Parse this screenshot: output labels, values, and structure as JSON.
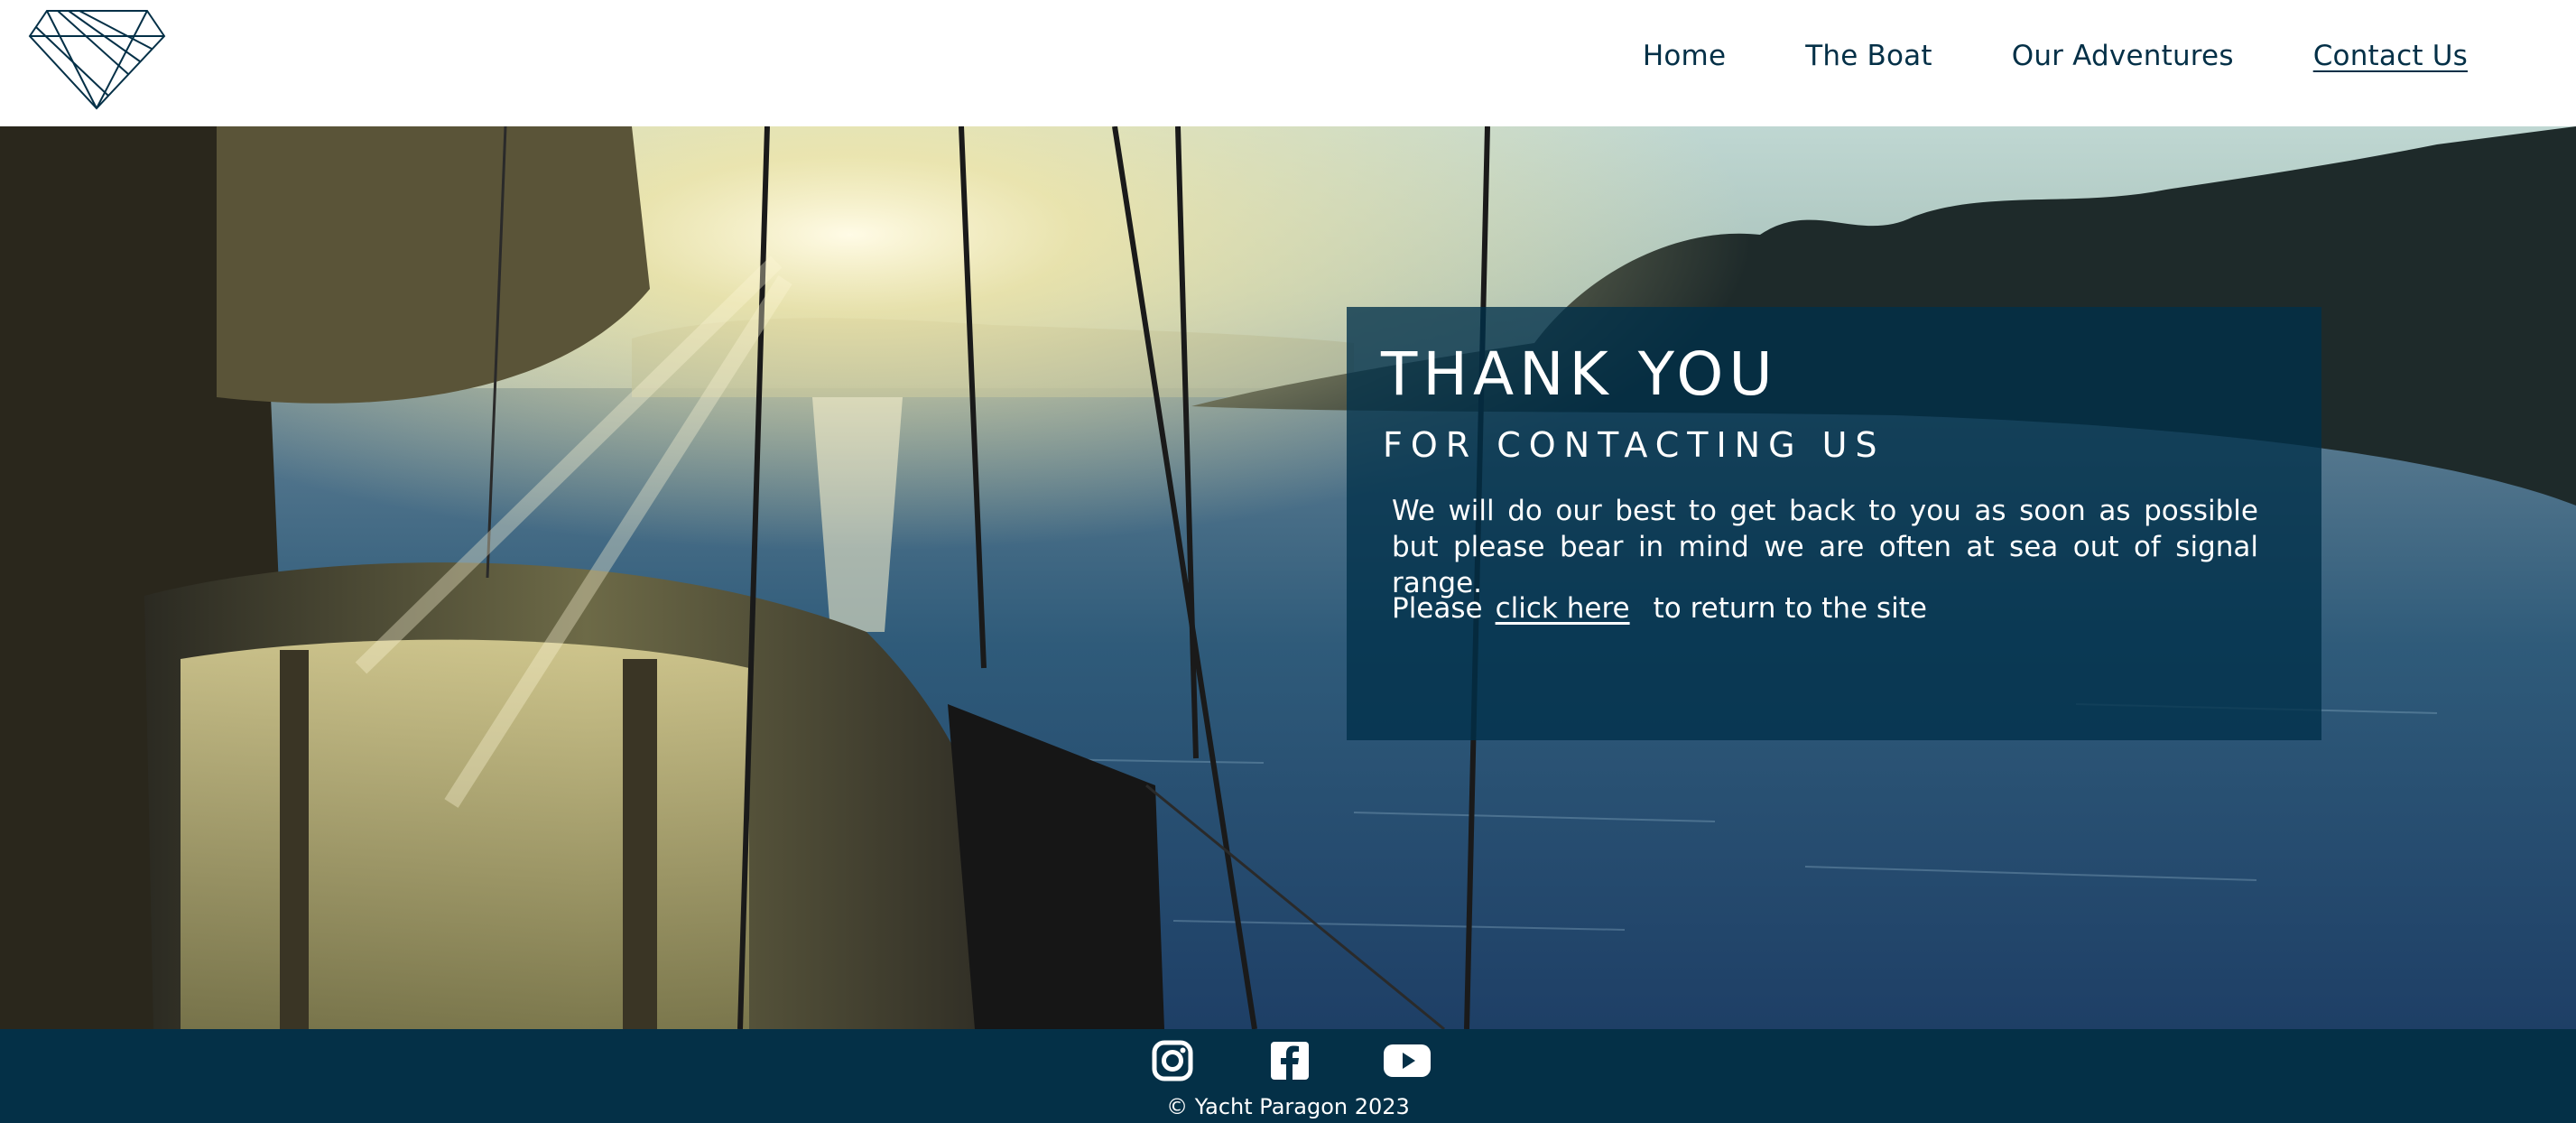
{
  "header": {
    "logo_icon": "diamond-logo-icon",
    "nav": [
      {
        "label": "Home"
      },
      {
        "label": "The Boat"
      },
      {
        "label": "Our Adventures"
      },
      {
        "label": "Contact Us",
        "active": true
      }
    ]
  },
  "hero": {
    "background_icon": "sailboat-sunset-photo",
    "title": "THANK YOU",
    "subtitle": "FOR CONTACTING US",
    "message": "We will do our best to get back to you as soon as possible but please bear in mind we are often at sea out of signal range.",
    "return_prefix": "Please",
    "return_link": "click here",
    "return_suffix": "to return to the site"
  },
  "footer": {
    "social": [
      {
        "icon": "instagram-icon"
      },
      {
        "icon": "facebook-icon"
      },
      {
        "icon": "youtube-icon"
      }
    ],
    "copyright": "© Yacht Paragon 2023"
  },
  "colors": {
    "brand_navy": "#043047",
    "panel_overlay": "rgba(0,48,73,0.78)",
    "text_light": "#ffffff"
  }
}
